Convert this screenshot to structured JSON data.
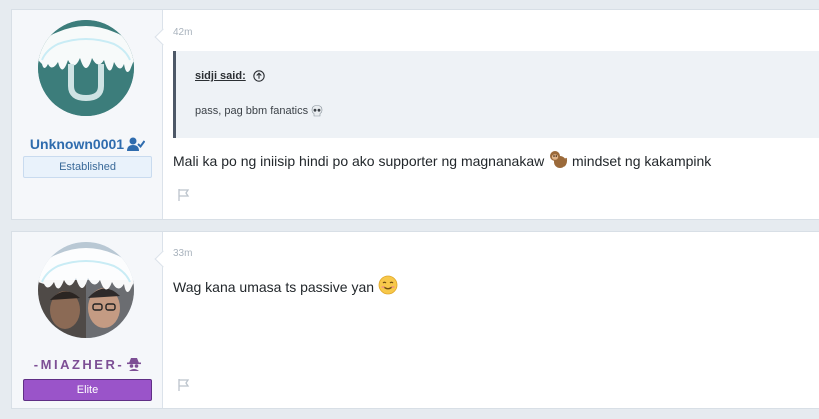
{
  "posts": [
    {
      "username": "Unknown0001",
      "badge": "Established",
      "time": "42m",
      "quote": {
        "author_label": "sidji said:",
        "text": "pass, pag bbm fanatics"
      },
      "message_before_emoji": "Mali ka po ng iniisip hindi po ako supporter ng magnanakaw ",
      "message_after_emoji": " mindset ng kakampink",
      "icons": [
        "user-check-icon",
        "monkey-emoji",
        "skull-emoji",
        "flag-icon",
        "arrow-up-circle-icon"
      ],
      "colors": {
        "username": "#2f6cae",
        "badge_bg": "#e9f2fb"
      }
    },
    {
      "username": "-MIAZHER-",
      "badge": "Elite",
      "time": "33m",
      "message": "Wag kana umasa ts passive yan ",
      "icons": [
        "spy-icon",
        "smiling-emoji",
        "flag-icon"
      ],
      "colors": {
        "username": "#7d4f95",
        "badge_bg": "#9a54c9"
      }
    }
  ]
}
